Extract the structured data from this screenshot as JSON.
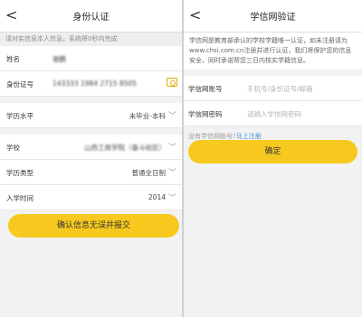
{
  "left": {
    "title": "身份认证",
    "back_glyph": "<",
    "tip": "请对实信息本人信息，系统将0秒内完成",
    "fields": {
      "name_label": "姓名",
      "name_value": "谢鹏",
      "id_label": "身份证号",
      "id_value": "143333 1984 2715 8505",
      "edu_label": "学历水平",
      "edu_value": "未毕业-本科",
      "school_label": "学校",
      "school_value": "山西工商学院（奋斗校区）",
      "type_label": "学历类型",
      "type_value": "普通全日制",
      "year_label": "入学时间",
      "year_value": "2014"
    },
    "submit_label": "确认信息无误并报交"
  },
  "right": {
    "title": "学信网验证",
    "back_glyph": "<",
    "tip": "学信网是教育部承认的学校学籍唯一认证，如未注册请为www.chsi.com.cn注册并进行认证，我们将保护您的信息安全，同时承诺帮您三日内核实学籍信息。",
    "account_label": "学信网账号",
    "account_placeholder": "手机号/身份证号/邮箱",
    "password_label": "学信网密码",
    "password_placeholder": "请输入学信网密码",
    "no_account_text": "没有学信网账号?",
    "register_link": "马上注册",
    "confirm_label": "确定"
  }
}
